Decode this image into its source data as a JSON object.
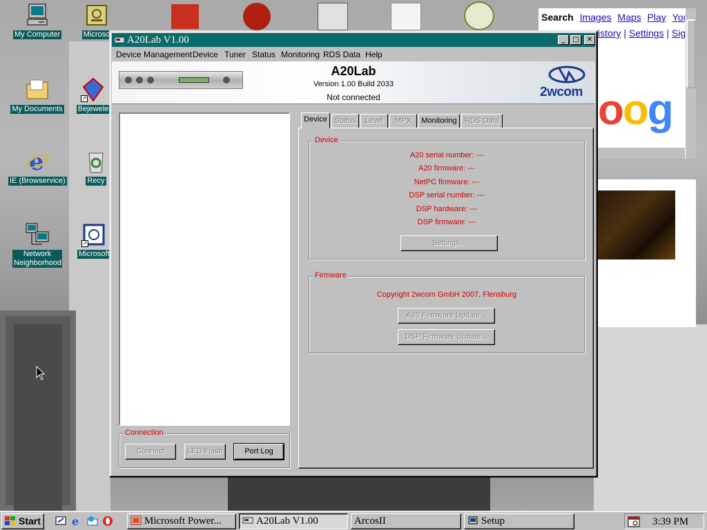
{
  "desktop": {
    "icons": [
      {
        "label": "My Computer",
        "icon": "computer-icon"
      },
      {
        "label": "Microso",
        "icon": "app-shortcut-icon"
      },
      {
        "label": "My Documents",
        "icon": "folder-icon"
      },
      {
        "label": "Bejewele",
        "icon": "game-icon"
      },
      {
        "label": "IE (Browservice)",
        "icon": "internet-explorer-icon"
      },
      {
        "label": "Recy",
        "icon": "recycle-bin-icon"
      },
      {
        "label": "Network Neighborhood",
        "icon": "network-icon"
      },
      {
        "label": "Microsoft",
        "icon": "app-shortcut-icon"
      }
    ]
  },
  "browser": {
    "search_label": "Search",
    "links": [
      "Images",
      "Maps",
      "Play",
      "YouT"
    ],
    "links2": [
      "istory",
      "Settings",
      "Sign"
    ],
    "logo_text": "oog"
  },
  "window": {
    "title": "A20Lab V1.00",
    "controls": {
      "minimize": "_",
      "maximize": "□",
      "close": "✕"
    },
    "menu": [
      "Device Management",
      "Device",
      "Tuner",
      "Status",
      "Monitoring",
      "RDS Data",
      "Help"
    ],
    "banner": {
      "app_name": "A20Lab",
      "version": "Version 1.00 Build 2033",
      "status": "Not connected",
      "brand": "2wcom"
    },
    "connection": {
      "title": "Connection",
      "connect_label": "Connect",
      "led_flash_label": "LED Flash",
      "port_log_label": "Port Log"
    },
    "tabs": [
      {
        "label": "Device",
        "state": "active"
      },
      {
        "label": "Status",
        "state": "disabled"
      },
      {
        "label": "Level",
        "state": "disabled"
      },
      {
        "label": "MPX",
        "state": "disabled"
      },
      {
        "label": "Monitoring",
        "state": "enabled"
      },
      {
        "label": "RDS Data",
        "state": "disabled"
      }
    ],
    "device_group": {
      "title": "Device",
      "fields": [
        "A20 serial number: ---",
        "A20 firmware: ---",
        "NetPC firmware: ---",
        "DSP serial number: ---",
        "DSP hardware: ---",
        "DSP firmware: ---"
      ],
      "settings_label": "Settings..."
    },
    "firmware_group": {
      "title": "Firmware",
      "copyright": "Copyright 2wcom GmbH 2007, Flensburg",
      "a20_update_label": "A20 Firmware Update...",
      "dsp_update_label": "DSP Firmware Update..."
    }
  },
  "taskbar": {
    "start_label": "Start",
    "tasks": [
      {
        "label": "Microsoft Power...",
        "icon": "powerpoint-icon"
      },
      {
        "label": "A20Lab V1.00",
        "icon": "a20lab-icon",
        "active": true
      },
      {
        "label": "ArcosII",
        "icon": ""
      },
      {
        "label": "Setup",
        "icon": "setup-icon"
      }
    ],
    "clock": "3:39 PM"
  },
  "colors": {
    "titlebar": "#0b6a6a",
    "label_red": "#d40000",
    "face": "#c0c0c0",
    "desktop_label_bg": "#0a5a5a"
  }
}
